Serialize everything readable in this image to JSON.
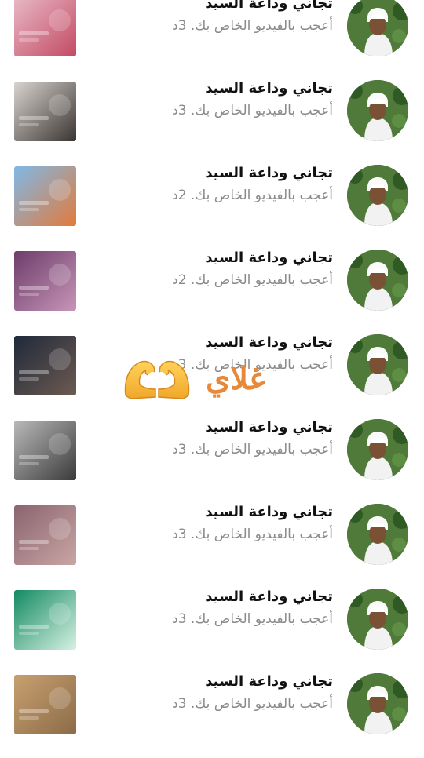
{
  "notifications": [
    {
      "name": "تجاني وداعة السيد",
      "message": "أعجب بالفيديو الخاص بك. 3د",
      "thumb_colors": [
        "#e8b9c6",
        "#c34a63"
      ]
    },
    {
      "name": "تجاني وداعة السيد",
      "message": "أعجب بالفيديو الخاص بك. 3د",
      "thumb_colors": [
        "#d9d4cf",
        "#3a3532"
      ]
    },
    {
      "name": "تجاني وداعة السيد",
      "message": "أعجب بالفيديو الخاص بك. 2د",
      "thumb_colors": [
        "#7fb9e6",
        "#e27a3b"
      ]
    },
    {
      "name": "تجاني وداعة السيد",
      "message": "أعجب بالفيديو الخاص بك. 2د",
      "thumb_colors": [
        "#6d3d6b",
        "#c795b7"
      ]
    },
    {
      "name": "تجاني وداعة السيد",
      "message": "أعجب بالفيديو الخاص بك. 3د",
      "thumb_colors": [
        "#1f2a3a",
        "#6d5a51"
      ]
    },
    {
      "name": "تجاني وداعة السيد",
      "message": "أعجب بالفيديو الخاص بك. 3د",
      "thumb_colors": [
        "#b9b9b9",
        "#3b3b3b"
      ]
    },
    {
      "name": "تجاني وداعة السيد",
      "message": "أعجب بالفيديو الخاص بك. 3د",
      "thumb_colors": [
        "#8a6470",
        "#c9a6a3"
      ]
    },
    {
      "name": "تجاني وداعة السيد",
      "message": "أعجب بالفيديو الخاص بك. 3د",
      "thumb_colors": [
        "#138a62",
        "#d7f1e4"
      ]
    },
    {
      "name": "تجاني وداعة السيد",
      "message": "أعجب بالفيديو الخاص بك. 3د",
      "thumb_colors": [
        "#c8a070",
        "#8b6b48"
      ]
    }
  ],
  "overlay": {
    "text": "غلاي",
    "emoji_icon": "heart-hands-icon",
    "color": "#e8893a"
  },
  "colors": {
    "name_text": "#111111",
    "message_text": "#8a8a8a",
    "background": "#ffffff"
  }
}
